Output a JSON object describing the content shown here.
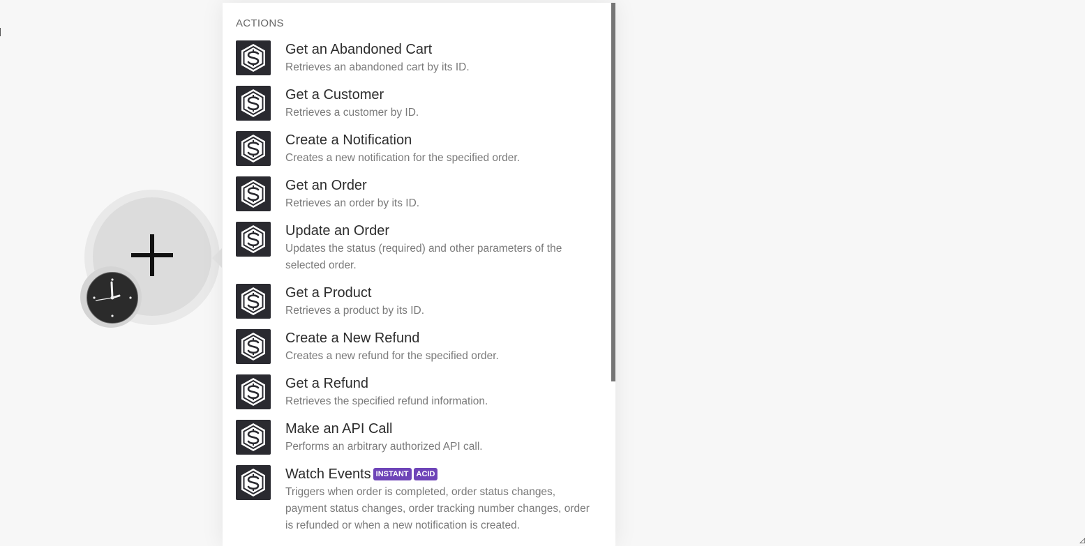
{
  "panel": {
    "section_label": "ACTIONS",
    "actions": [
      {
        "title": "Get an Abandoned Cart",
        "desc": "Retrieves an abandoned cart by its ID."
      },
      {
        "title": "Get a Customer",
        "desc": "Retrieves a customer by ID."
      },
      {
        "title": "Create a Notification",
        "desc": "Creates a new notification for the specified order."
      },
      {
        "title": "Get an Order",
        "desc": "Retrieves an order by its ID."
      },
      {
        "title": "Update an Order",
        "desc": "Updates the status (required) and other parameters of the selected order."
      },
      {
        "title": "Get a Product",
        "desc": "Retrieves a product by its ID."
      },
      {
        "title": "Create a New Refund",
        "desc": "Creates a new refund for the specified order."
      },
      {
        "title": "Get a Refund",
        "desc": "Retrieves the specified refund information."
      },
      {
        "title": "Make an API Call",
        "desc": "Performs an arbitrary authorized API call."
      },
      {
        "title": "Watch Events",
        "desc": "Triggers when order is completed, order status changes, payment status changes, order tracking number changes, order is refunded or when a new notification is created.",
        "badges": [
          "INSTANT",
          "ACID"
        ]
      }
    ],
    "app_icon": "app-logo-s-icon"
  },
  "module": {
    "icon": "plus-icon",
    "schedule_icon": "clock-icon"
  },
  "colors": {
    "badge": "#6e44b8",
    "app_icon_bg": "#2a2a30",
    "canvas_bg": "#f7f7f7"
  }
}
